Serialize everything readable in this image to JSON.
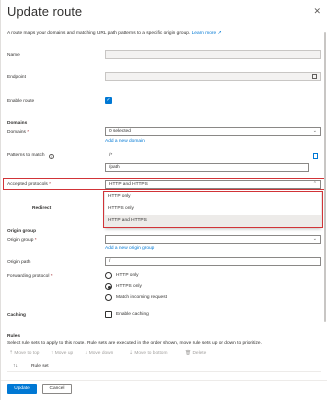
{
  "header": {
    "title": "Update route"
  },
  "description": {
    "text": "A route maps your domains and matching URL path patterns to a specific origin group.",
    "link": "Learn more"
  },
  "name": {
    "label": "Name",
    "value": ""
  },
  "endpoint": {
    "label": "Endpoint",
    "value": ""
  },
  "enable_route": {
    "label": "Enable route",
    "checked": true
  },
  "domains": {
    "section": "Domains",
    "label": "Domains",
    "required": "*",
    "value": "0 selected",
    "add_link": "Add a new domain"
  },
  "patterns": {
    "label": "Patterns to match",
    "values": [
      "/*",
      "/path"
    ]
  },
  "accepted_protocols": {
    "label": "Accepted protocols",
    "required": "*",
    "value": "HTTP and HTTPS",
    "options": [
      "HTTP only",
      "HTTPS only",
      "HTTP and HTTPS"
    ],
    "selected_index": 2
  },
  "redirect": {
    "section": "Redirect"
  },
  "origin_group": {
    "section": "Origin group",
    "label": "Origin group",
    "required": "*",
    "value": "",
    "add_link": "Add a new origin group"
  },
  "origin_path": {
    "label": "Origin path",
    "value": "/"
  },
  "forwarding_protocol": {
    "label": "Forwarding protocol",
    "required": "*",
    "options": [
      "HTTP only",
      "HTTPS only",
      "Match incoming request"
    ],
    "selected_index": 1
  },
  "caching": {
    "section": "Caching",
    "checkbox_label": "Enable caching",
    "checked": false
  },
  "rules": {
    "section": "Rules",
    "description": "Select rule sets to apply to this route. Rule sets are executed in the order shown, move rule sets up or down to prioritize.",
    "toolbar": [
      "Move to top",
      "Move up",
      "Move down",
      "Move to bottom",
      "Delete"
    ],
    "column_header": "Rule set"
  },
  "footer": {
    "update_label": "Update",
    "cancel_label": "Cancel"
  },
  "colors": {
    "accent": "#0078d4",
    "highlight_border": "#d13438",
    "required": "#a4262c"
  }
}
